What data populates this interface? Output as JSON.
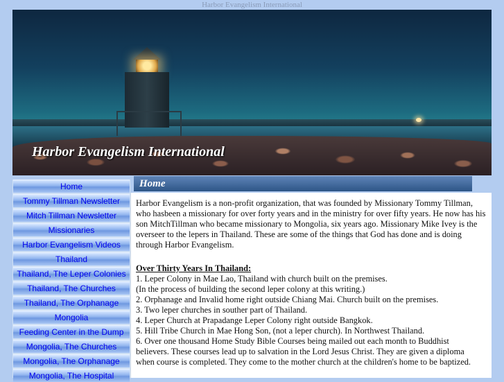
{
  "browser": {
    "title": "Harbor Evangelism International"
  },
  "banner": {
    "title": "Harbor Evangelism International"
  },
  "page": {
    "heading": "Home"
  },
  "nav": {
    "items": [
      {
        "label": "Home"
      },
      {
        "label": "Tommy Tillman Newsletter"
      },
      {
        "label": "Mitch Tillman Newsletter"
      },
      {
        "label": "Missionaries"
      },
      {
        "label": "Harbor Evangelism Videos"
      },
      {
        "label": "Thailand"
      },
      {
        "label": "Thailand, The Leper Colonies"
      },
      {
        "label": "Thailand, The Churches"
      },
      {
        "label": "Thailand, The Orphanage"
      },
      {
        "label": "Mongolia"
      },
      {
        "label": "Feeding Center in the Dump"
      },
      {
        "label": "Mongolia, The Churches"
      },
      {
        "label": "Mongolia, The Orphanage"
      },
      {
        "label": "Mongolia, The Hospital"
      }
    ]
  },
  "content": {
    "intro": "Harbor Evangelism is a non-profit organization, that was founded by Missionary Tommy Tillman, who hasbeen a missionary for over forty years and in the ministry for over fifty years. He now has his son MitchTillman who became missionary to Mongolia, six years ago. Missionary Mike Ivey is the overseer to the lepers in Thailand. These are some of the things that God has done and is doing through Harbor Evangelism.",
    "section_title": "Over Thirty Years In Thailand:",
    "lines": [
      "1. Leper Colony in Mae Lao, Thailand with church built on the premises.",
      "(In the process of building the second leper colony at this writing.)",
      "2. Orphanage and Invalid home right outside Chiang Mai. Church built on the premises.",
      "3. Two leper churches in souther part of Thailand.",
      "4. Leper Church at Prapadange Leper Colony right outside Bangkok.",
      "5. Hill Tribe Church in Mae Hong Son, (not a leper church). In Northwest Thailand.",
      "6. Over one thousand Home Study Bible Courses being mailed out each month to Buddhist",
      "believers. These courses lead up to salvation in the Lord Jesus Christ. They are given a diploma",
      "when course is completed. They come to the mother church at the children's home to be baptized."
    ]
  }
}
